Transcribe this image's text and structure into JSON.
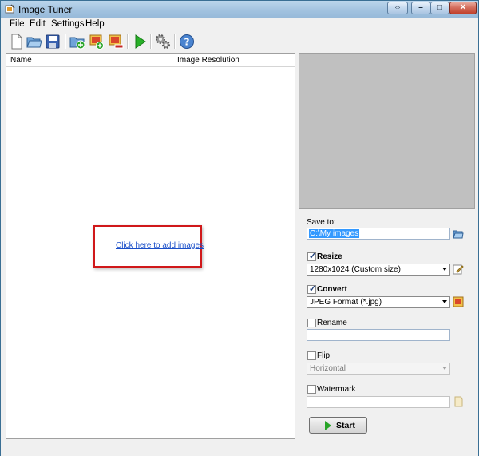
{
  "window": {
    "title": "Image Tuner"
  },
  "menu": {
    "items": [
      "File",
      "Edit",
      "Settings",
      "Help"
    ]
  },
  "toolbar": {
    "buttons": [
      "new-file-icon",
      "open-folder-icon",
      "save-icon",
      "add-folder-icon",
      "add-images-icon",
      "remove-images-icon",
      "start-icon",
      "settings-icon",
      "help-icon"
    ]
  },
  "list": {
    "columns": [
      "Name",
      "Image Resolution"
    ],
    "empty_link": "Click here to add images"
  },
  "options": {
    "save_to_label": "Save to:",
    "save_to_value": "C:\\My images",
    "resize_label": "Resize",
    "resize_checked": true,
    "resize_value": "1280x1024 (Custom size)",
    "convert_label": "Convert",
    "convert_checked": true,
    "convert_value": "JPEG Format (*.jpg)",
    "rename_label": "Rename",
    "rename_checked": false,
    "rename_value": "",
    "flip_label": "Flip",
    "flip_checked": false,
    "flip_value": "Horizontal",
    "watermark_label": "Watermark",
    "watermark_checked": false,
    "watermark_value": "",
    "start_label": "Start"
  },
  "colors": {
    "highlight_box": "#d0181a",
    "link": "#1a4fc9",
    "preview_bg": "#c0c0c0"
  }
}
